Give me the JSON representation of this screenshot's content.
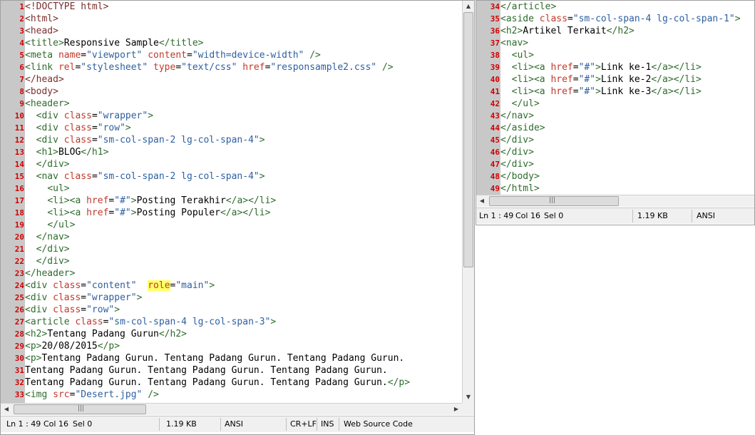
{
  "left_pane": {
    "lines": [
      {
        "n": "1",
        "t": [
          [
            "tk-tag",
            "<!DOCTYPE html>"
          ]
        ]
      },
      {
        "n": "2",
        "t": [
          [
            "tk-tag",
            "<html>"
          ]
        ]
      },
      {
        "n": "3",
        "t": [
          [
            "tk-tag",
            "<head>"
          ]
        ]
      },
      {
        "n": "4",
        "t": [
          [
            "tk-tg",
            "<title>"
          ],
          [
            "",
            "Responsive Sample"
          ],
          [
            "tk-tg",
            "</title>"
          ]
        ]
      },
      {
        "n": "5",
        "t": [
          [
            "tk-tg",
            "<meta "
          ],
          [
            "tk-attr",
            "name"
          ],
          [
            "",
            "="
          ],
          [
            "tk-val",
            "\"viewport\""
          ],
          [
            "",
            ""
          ],
          [
            "tk-attr",
            " content"
          ],
          [
            "",
            "="
          ],
          [
            "tk-val",
            "\"width=device-width\""
          ],
          [
            "tk-tg",
            " />"
          ]
        ]
      },
      {
        "n": "6",
        "t": [
          [
            "tk-tg",
            "<link "
          ],
          [
            "tk-attr",
            "rel"
          ],
          [
            "",
            "="
          ],
          [
            "tk-val",
            "\"stylesheet\""
          ],
          [
            "tk-attr",
            " type"
          ],
          [
            "",
            "="
          ],
          [
            "tk-val",
            "\"text/css\""
          ],
          [
            "tk-attr",
            " href"
          ],
          [
            "",
            "="
          ],
          [
            "tk-val",
            "\"responsample2.css\""
          ],
          [
            "tk-tg",
            " />"
          ]
        ]
      },
      {
        "n": "7",
        "t": [
          [
            "tk-tag",
            "</head>"
          ]
        ]
      },
      {
        "n": "8",
        "t": [
          [
            "tk-tag",
            "<body>"
          ]
        ]
      },
      {
        "n": "9",
        "t": [
          [
            "tk-tg",
            "<header>"
          ]
        ]
      },
      {
        "n": "10",
        "t": [
          [
            "",
            "  "
          ],
          [
            "tk-tg",
            "<div "
          ],
          [
            "tk-attr",
            "class"
          ],
          [
            "",
            "="
          ],
          [
            "tk-val",
            "\"wrapper\""
          ],
          [
            "tk-tg",
            ">"
          ]
        ]
      },
      {
        "n": "11",
        "t": [
          [
            "",
            "  "
          ],
          [
            "tk-tg",
            "<div "
          ],
          [
            "tk-attr",
            "class"
          ],
          [
            "",
            "="
          ],
          [
            "tk-val",
            "\"row\""
          ],
          [
            "tk-tg",
            ">"
          ]
        ]
      },
      {
        "n": "12",
        "t": [
          [
            "",
            "  "
          ],
          [
            "tk-tg",
            "<div "
          ],
          [
            "tk-attr",
            "class"
          ],
          [
            "",
            "="
          ],
          [
            "tk-val",
            "\"sm-col-span-2 lg-col-span-4\""
          ],
          [
            "tk-tg",
            ">"
          ]
        ]
      },
      {
        "n": "13",
        "t": [
          [
            "",
            "  "
          ],
          [
            "tk-tg",
            "<h1>"
          ],
          [
            "",
            "BLOG"
          ],
          [
            "tk-tg",
            "</h1>"
          ]
        ]
      },
      {
        "n": "14",
        "t": [
          [
            "",
            "  "
          ],
          [
            "tk-tg",
            "</div>"
          ]
        ]
      },
      {
        "n": "15",
        "t": [
          [
            "",
            "  "
          ],
          [
            "tk-tg",
            "<nav "
          ],
          [
            "tk-attr",
            "class"
          ],
          [
            "",
            "="
          ],
          [
            "tk-val",
            "\"sm-col-span-2 lg-col-span-4\""
          ],
          [
            "tk-tg",
            ">"
          ]
        ]
      },
      {
        "n": "16",
        "t": [
          [
            "",
            "    "
          ],
          [
            "tk-tg",
            "<ul>"
          ]
        ]
      },
      {
        "n": "17",
        "t": [
          [
            "",
            "    "
          ],
          [
            "tk-tg",
            "<li><a "
          ],
          [
            "tk-attr",
            "href"
          ],
          [
            "",
            "="
          ],
          [
            "tk-val",
            "\"#\""
          ],
          [
            "tk-tg",
            ">"
          ],
          [
            "",
            "Posting Terakhir"
          ],
          [
            "tk-tg",
            "</a></li>"
          ]
        ]
      },
      {
        "n": "18",
        "t": [
          [
            "",
            "    "
          ],
          [
            "tk-tg",
            "<li><a "
          ],
          [
            "tk-attr",
            "href"
          ],
          [
            "",
            "="
          ],
          [
            "tk-val",
            "\"#\""
          ],
          [
            "tk-tg",
            ">"
          ],
          [
            "",
            "Posting Populer"
          ],
          [
            "tk-tg",
            "</a></li>"
          ]
        ]
      },
      {
        "n": "19",
        "t": [
          [
            "",
            "    "
          ],
          [
            "tk-tg",
            "</ul>"
          ]
        ]
      },
      {
        "n": "20",
        "t": [
          [
            "",
            "  "
          ],
          [
            "tk-tg",
            "</nav>"
          ]
        ]
      },
      {
        "n": "21",
        "t": [
          [
            "",
            "  "
          ],
          [
            "tk-tg",
            "</div>"
          ]
        ]
      },
      {
        "n": "22",
        "t": [
          [
            "",
            "  "
          ],
          [
            "tk-tg",
            "</div>"
          ]
        ]
      },
      {
        "n": "23",
        "t": [
          [
            "tk-tg",
            "</header>"
          ]
        ]
      },
      {
        "n": "24",
        "t": [
          [
            "tk-tg",
            "<div "
          ],
          [
            "tk-attr",
            "class"
          ],
          [
            "",
            "="
          ],
          [
            "tk-val",
            "\"content\""
          ],
          [
            "",
            ""
          ],
          [
            "",
            "  "
          ],
          [
            "tk-hl",
            "role"
          ],
          [
            "",
            "="
          ],
          [
            "tk-val",
            "\"main\""
          ],
          [
            "tk-tg",
            ">"
          ]
        ]
      },
      {
        "n": "25",
        "t": [
          [
            "tk-tg",
            "<div "
          ],
          [
            "tk-attr",
            "class"
          ],
          [
            "",
            "="
          ],
          [
            "tk-val",
            "\"wrapper\""
          ],
          [
            "tk-tg",
            ">"
          ]
        ]
      },
      {
        "n": "26",
        "t": [
          [
            "tk-tg",
            "<div "
          ],
          [
            "tk-attr",
            "class"
          ],
          [
            "",
            "="
          ],
          [
            "tk-val",
            "\"row\""
          ],
          [
            "tk-tg",
            ">"
          ]
        ]
      },
      {
        "n": "27",
        "t": [
          [
            "tk-tg",
            "<article "
          ],
          [
            "tk-attr",
            "class"
          ],
          [
            "",
            "="
          ],
          [
            "tk-val",
            "\"sm-col-span-4 lg-col-span-3\""
          ],
          [
            "tk-tg",
            ">"
          ]
        ]
      },
      {
        "n": "28",
        "t": [
          [
            "tk-tg",
            "<h2>"
          ],
          [
            "",
            "Tentang Padang Gurun"
          ],
          [
            "tk-tg",
            "</h2>"
          ]
        ]
      },
      {
        "n": "29",
        "t": [
          [
            "tk-tg",
            "<p>"
          ],
          [
            "",
            "20/08/2015"
          ],
          [
            "tk-tg",
            "</p>"
          ]
        ]
      },
      {
        "n": "30",
        "t": [
          [
            "tk-tg",
            "<p>"
          ],
          [
            "",
            "Tentang Padang Gurun. Tentang Padang Gurun. Tentang Padang Gurun."
          ]
        ]
      },
      {
        "n": "31",
        "t": [
          [
            "",
            "Tentang Padang Gurun. Tentang Padang Gurun. Tentang Padang Gurun."
          ]
        ]
      },
      {
        "n": "32",
        "t": [
          [
            "",
            "Tentang Padang Gurun. Tentang Padang Gurun. Tentang Padang Gurun."
          ],
          [
            "tk-tg",
            "</p>"
          ]
        ]
      },
      {
        "n": "33",
        "t": [
          [
            "tk-tg",
            "<img "
          ],
          [
            "tk-attr",
            "src"
          ],
          [
            "",
            "="
          ],
          [
            "tk-val",
            "\"Desert.jpg\""
          ],
          [
            "tk-tg",
            " />"
          ]
        ]
      }
    ],
    "status": {
      "position": "Ln 1 : 49",
      "col": "Col 16",
      "sel": "Sel 0",
      "size": "1.19 KB",
      "encoding": "ANSI",
      "eol": "CR+LF",
      "mode": "INS",
      "lexer": "Web Source Code"
    }
  },
  "right_pane": {
    "lines": [
      {
        "n": "34",
        "t": [
          [
            "tk-tg",
            "</article>"
          ]
        ]
      },
      {
        "n": "35",
        "t": [
          [
            "tk-tg",
            "<aside "
          ],
          [
            "tk-attr",
            "class"
          ],
          [
            "",
            "="
          ],
          [
            "tk-val",
            "\"sm-col-span-4 lg-col-span-1\""
          ],
          [
            "tk-tg",
            ">"
          ]
        ]
      },
      {
        "n": "36",
        "t": [
          [
            "tk-tg",
            "<h2>"
          ],
          [
            "",
            "Artikel Terkait"
          ],
          [
            "tk-tg",
            "</h2>"
          ]
        ]
      },
      {
        "n": "37",
        "t": [
          [
            "tk-tg",
            "<nav>"
          ]
        ]
      },
      {
        "n": "38",
        "t": [
          [
            "",
            "  "
          ],
          [
            "tk-tg",
            "<ul>"
          ]
        ]
      },
      {
        "n": "39",
        "t": [
          [
            "",
            "  "
          ],
          [
            "tk-tg",
            "<li><a "
          ],
          [
            "tk-attr",
            "href"
          ],
          [
            "",
            "="
          ],
          [
            "tk-val",
            "\"#\""
          ],
          [
            "tk-tg",
            ">"
          ],
          [
            "",
            "Link ke-1"
          ],
          [
            "tk-tg",
            "</a></li>"
          ]
        ]
      },
      {
        "n": "40",
        "t": [
          [
            "",
            "  "
          ],
          [
            "tk-tg",
            "<li><a "
          ],
          [
            "tk-attr",
            "href"
          ],
          [
            "",
            "="
          ],
          [
            "tk-val",
            "\"#\""
          ],
          [
            "tk-tg",
            ">"
          ],
          [
            "",
            "Link ke-2"
          ],
          [
            "tk-tg",
            "</a></li>"
          ]
        ]
      },
      {
        "n": "41",
        "t": [
          [
            "",
            "  "
          ],
          [
            "tk-tg",
            "<li><a "
          ],
          [
            "tk-attr",
            "href"
          ],
          [
            "",
            "="
          ],
          [
            "tk-val",
            "\"#\""
          ],
          [
            "tk-tg",
            ">"
          ],
          [
            "",
            "Link ke-3"
          ],
          [
            "tk-tg",
            "</a></li>"
          ]
        ]
      },
      {
        "n": "42",
        "t": [
          [
            "",
            "  "
          ],
          [
            "tk-tg",
            "</ul>"
          ]
        ]
      },
      {
        "n": "43",
        "t": [
          [
            "tk-tg",
            "</nav>"
          ]
        ]
      },
      {
        "n": "44",
        "t": [
          [
            "tk-tg",
            "</aside>"
          ]
        ]
      },
      {
        "n": "45",
        "t": [
          [
            "tk-tg",
            "</div>"
          ]
        ]
      },
      {
        "n": "46",
        "t": [
          [
            "tk-tg",
            "</div>"
          ]
        ]
      },
      {
        "n": "47",
        "t": [
          [
            "tk-tg",
            "</div>"
          ]
        ]
      },
      {
        "n": "48",
        "t": [
          [
            "tk-tg",
            "</body>"
          ]
        ]
      },
      {
        "n": "49",
        "t": [
          [
            "tk-tg",
            "</html>"
          ]
        ]
      }
    ],
    "status": {
      "position": "Ln 1 : 49",
      "col": "Col 16",
      "sel": "Sel 0",
      "size": "1.19 KB",
      "encoding": "ANSI"
    }
  },
  "icons": {
    "up_arrow": "▲",
    "down_arrow": "▼",
    "left_arrow": "◀",
    "right_arrow": "▶",
    "grip_v": "≡",
    "grip_h": "|||"
  },
  "colors": {
    "gutter": "#c8c8c8",
    "line_number": "#d00000",
    "tag": "#7b2d2d",
    "attr": "#c0392b",
    "value": "#2e5fa0",
    "highlight": "#ffff66"
  }
}
